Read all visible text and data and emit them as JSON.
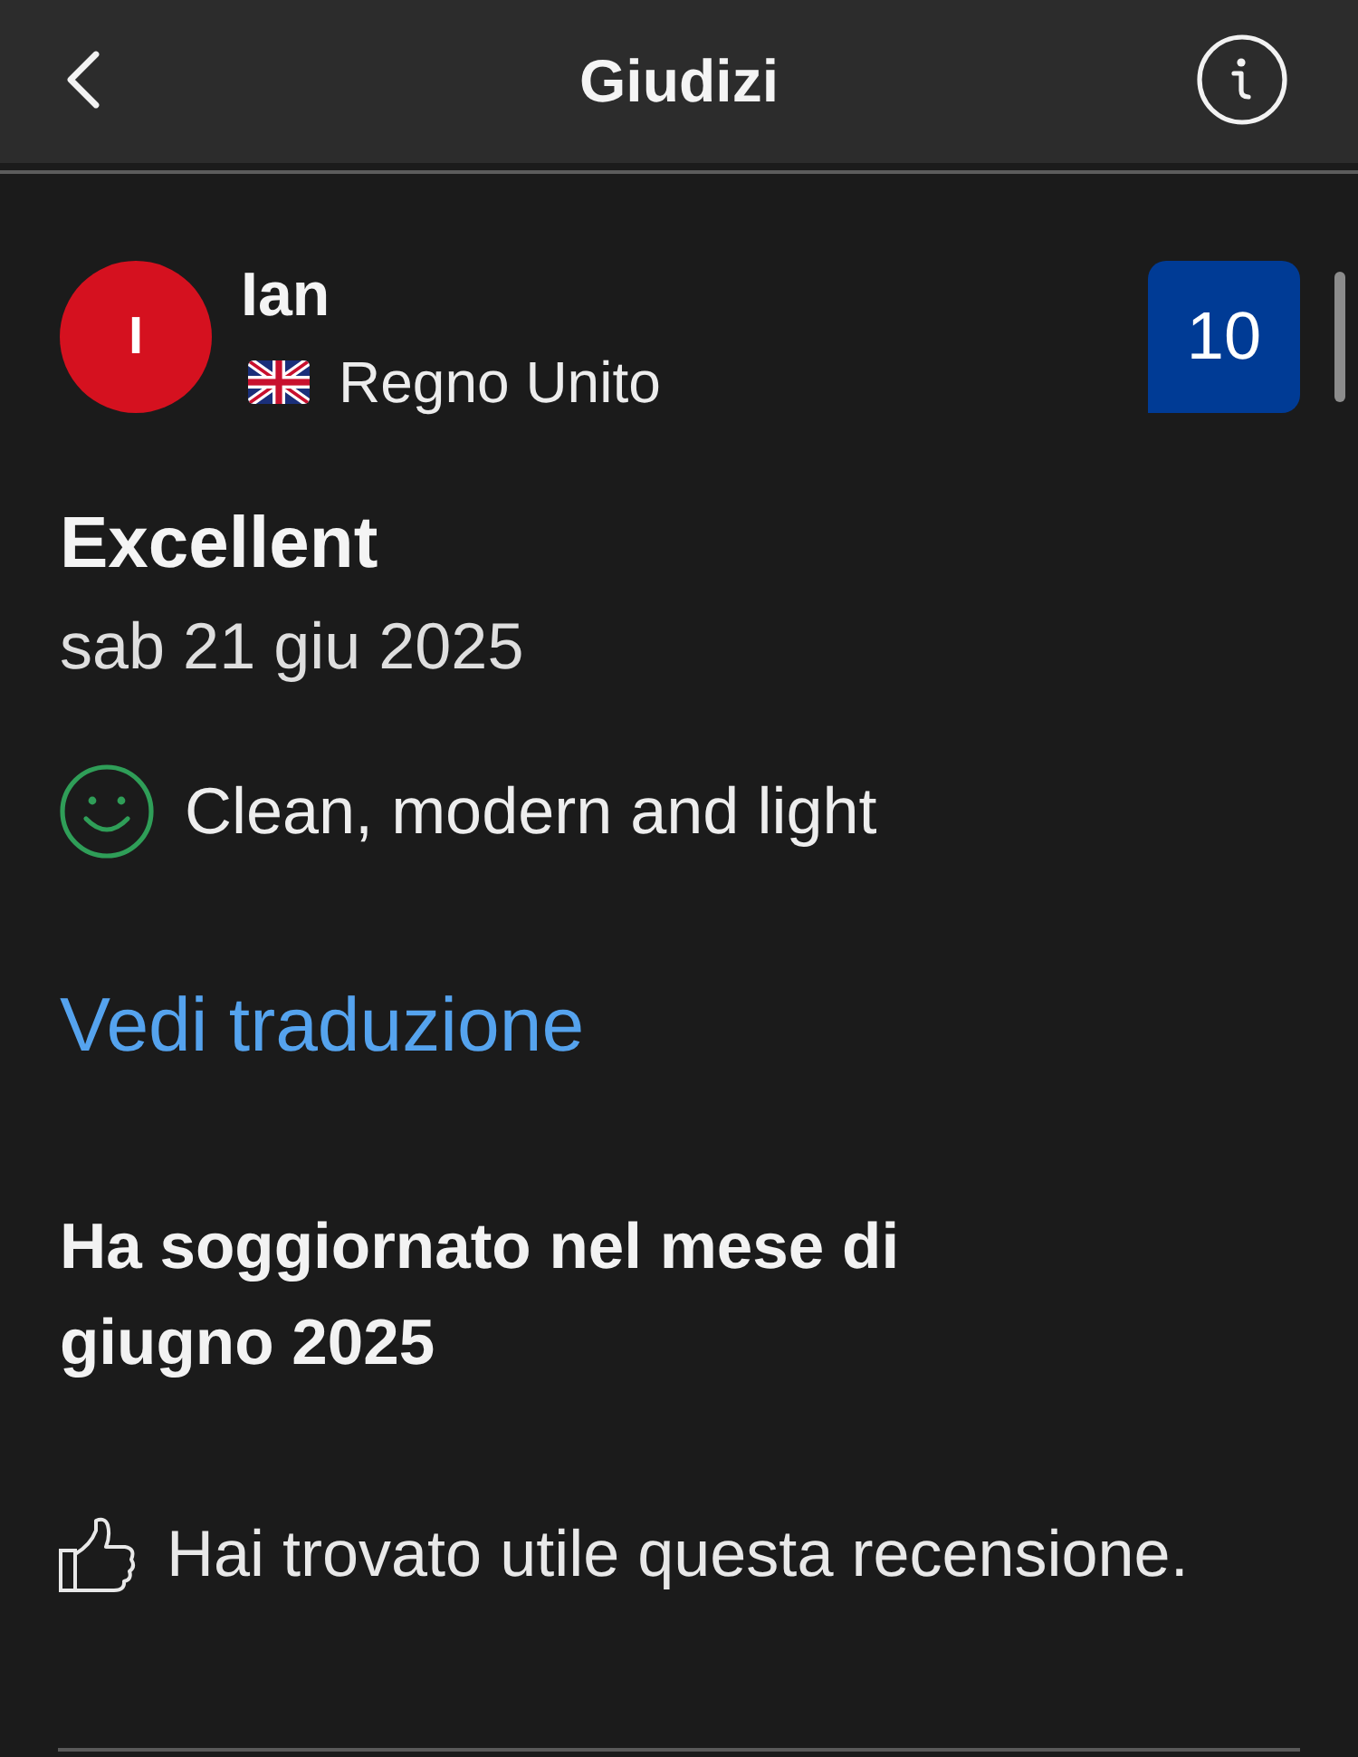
{
  "header": {
    "title": "Giudizi"
  },
  "review": {
    "reviewer": {
      "initial": "I",
      "name": "Ian",
      "country": "Regno Unito"
    },
    "score": "10",
    "title": "Excellent",
    "date": "sab 21 giu 2025",
    "comments": [
      {
        "kind": "positive",
        "text": "Clean, modern and light"
      }
    ],
    "translate_link": "Vedi traduzione",
    "stay": "Ha soggiornato nel mese di giugno 2025",
    "helpful": "Hai trovato utile questa recensione."
  }
}
